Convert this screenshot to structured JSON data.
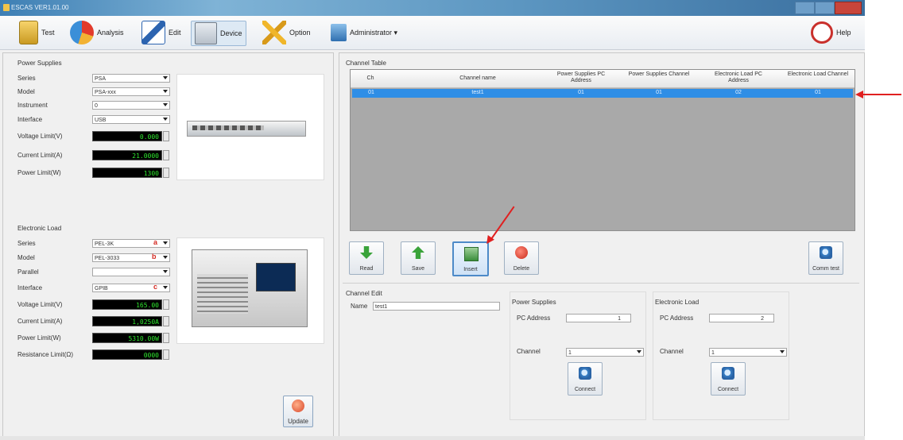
{
  "window": {
    "title": "ESCAS VER1.01.00"
  },
  "toolbar": {
    "test": "Test",
    "analysis": "Analysis",
    "edit": "Edit",
    "device": "Device",
    "option": "Option",
    "administrator": "Administrator ▾",
    "help": "Help"
  },
  "power_supplies": {
    "title": "Power Supplies",
    "rows": [
      {
        "label": "Series",
        "value": "PSA"
      },
      {
        "label": "Model",
        "value": "PSA-xxx"
      },
      {
        "label": "Instrument",
        "value": "0"
      },
      {
        "label": "Interface",
        "value": "USB"
      }
    ],
    "limits": [
      {
        "label": "Voltage Limit(V)",
        "value": "0.000"
      },
      {
        "label": "Current Limit(A)",
        "value": "21.0000"
      },
      {
        "label": "Power Limit(W)",
        "value": "1300"
      }
    ]
  },
  "electronic_load": {
    "title": "Electronic Load",
    "rows": [
      {
        "label": "Series",
        "value": "PEL-3K",
        "mark": "a"
      },
      {
        "label": "Model",
        "value": "PEL-3033",
        "mark": "b"
      },
      {
        "label": "Parallel",
        "value": "",
        "mark": ""
      },
      {
        "label": "Interface",
        "value": "GPIB",
        "mark": "c"
      }
    ],
    "limits": [
      {
        "label": "Voltage Limit(V)",
        "value": "165.00"
      },
      {
        "label": "Current Limit(A)",
        "value": "1,0250A"
      },
      {
        "label": "Power Limit(W)",
        "value": "5310.00W"
      },
      {
        "label": "Resistance Limit(Ω)",
        "value": "0000"
      }
    ]
  },
  "update_button": "Update",
  "channel_table": {
    "title": "Channel Table",
    "headers": [
      "Ch",
      "Channel name",
      "Power Supplies PC Address",
      "Power Supplies Channel",
      "Electronic Load PC Address",
      "Electronic Load Channel"
    ],
    "rows": [
      [
        "01",
        "test1",
        "01",
        "01",
        "02",
        "01"
      ]
    ]
  },
  "actions": {
    "read": "Read",
    "save": "Save",
    "insert": "Insert",
    "delete": "Delete",
    "comm_test": "Comm test"
  },
  "channel_edit": {
    "title": "Channel Edit",
    "name_label": "Name",
    "name_value": "test1",
    "power_supplies": {
      "title": "Power Supplies",
      "pc_address_label": "PC Address",
      "pc_address_value": "1",
      "channel_label": "Channel",
      "channel_value": "1",
      "connect": "Connect"
    },
    "electronic_load": {
      "title": "Electronic Load",
      "pc_address_label": "PC Address",
      "pc_address_value": "2",
      "channel_label": "Channel",
      "channel_value": "1",
      "connect": "Connect"
    }
  },
  "colors": {
    "selection": "#2f8ee6",
    "annotation_arrow": "#e02020"
  }
}
